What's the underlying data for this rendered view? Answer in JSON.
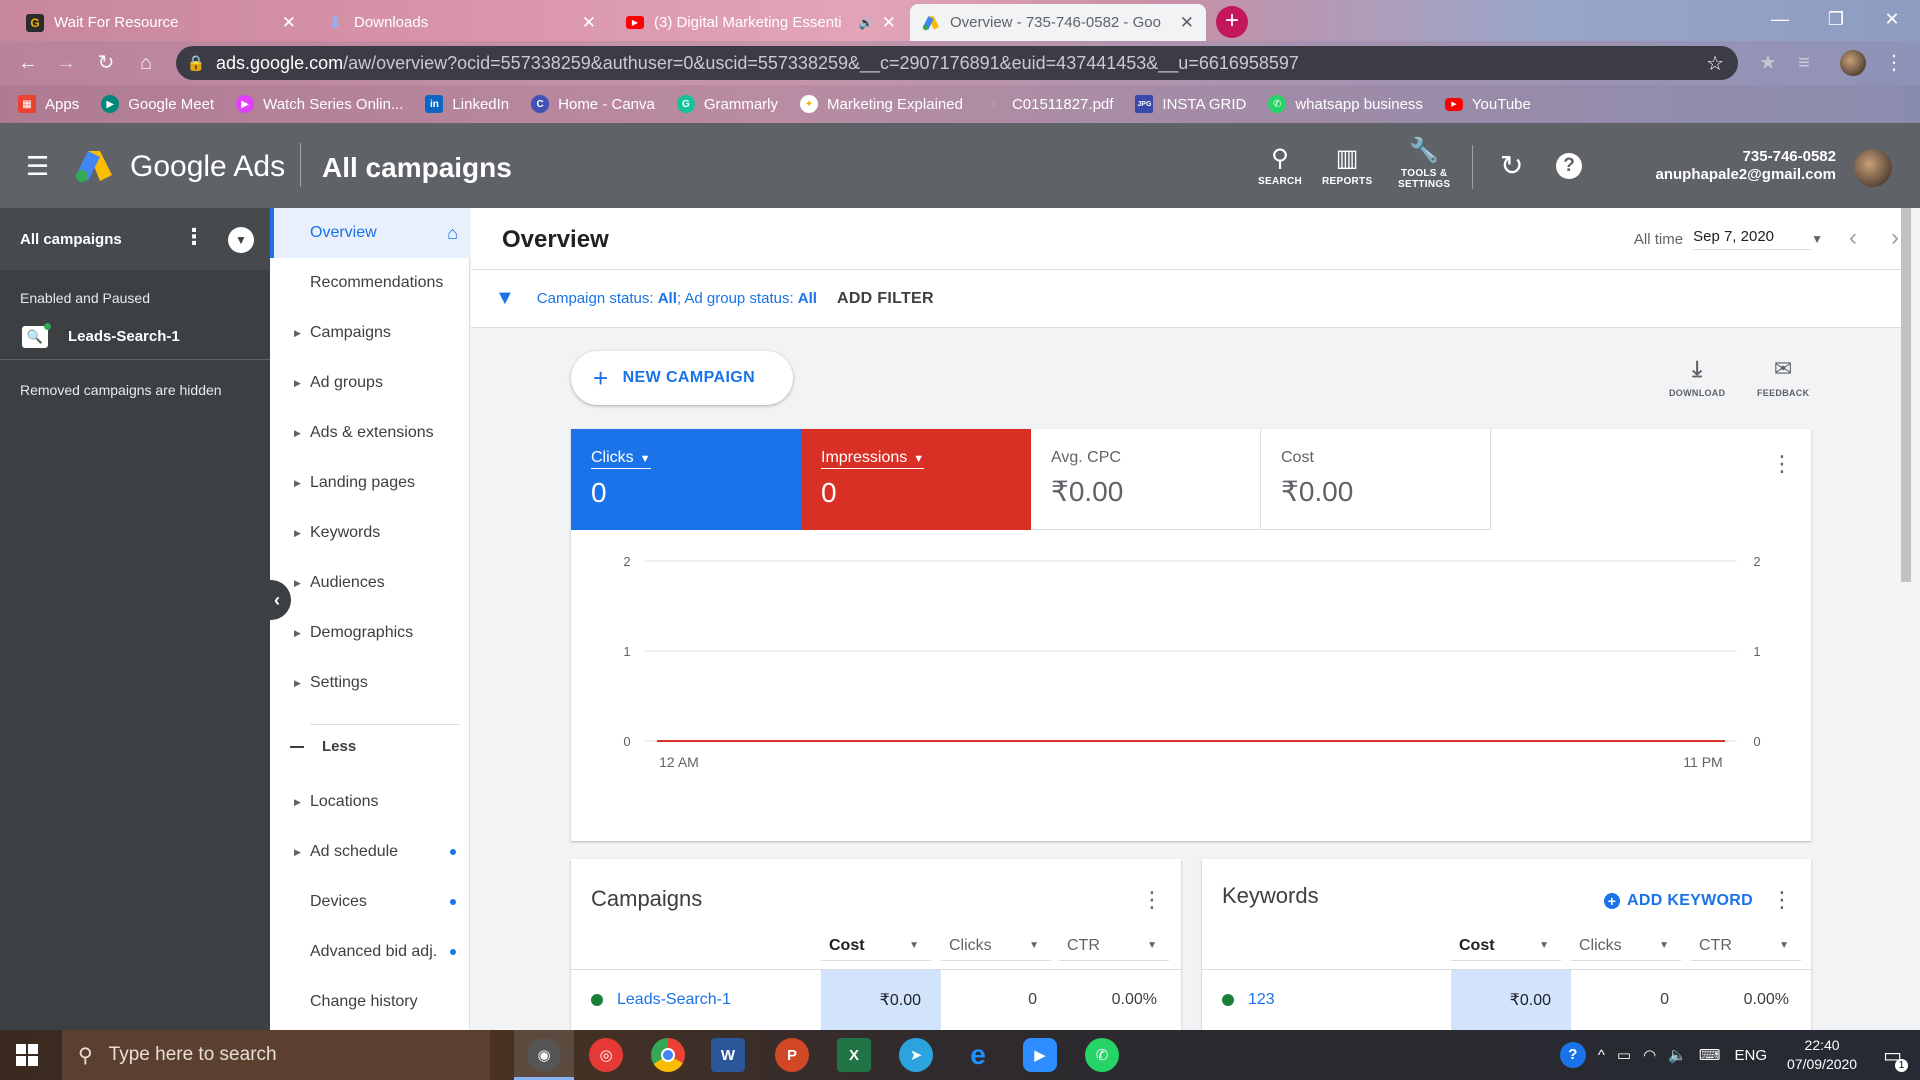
{
  "browser": {
    "tabs": [
      {
        "title": "Wait For Resource",
        "icon": "g-icon",
        "color": "#1a1a1a"
      },
      {
        "title": "Downloads",
        "icon": "download-icon",
        "color": "#4285f4"
      },
      {
        "title": "(3) Digital Marketing Essenti",
        "icon": "youtube-icon",
        "color": "#ff0000"
      },
      {
        "title": "Overview - 735-746-0582 - Goo",
        "icon": "google-ads-icon",
        "color": "#fbbc04"
      }
    ],
    "url_host": "ads.google.com",
    "url_path": "/aw/overview?ocid=557338259&authuser=0&uscid=557338259&__c=2907176891&euid=437441453&__u=6616958597",
    "bookmarks": [
      {
        "label": "Apps",
        "color": "#ea4335"
      },
      {
        "label": "Google Meet",
        "color": "#00897b"
      },
      {
        "label": "Watch Series Onlin...",
        "color": "#e040fb"
      },
      {
        "label": "LinkedIn",
        "color": "#0a66c2"
      },
      {
        "label": "Home - Canva",
        "color": "#00c4cc"
      },
      {
        "label": "Grammarly",
        "color": "#15c39a"
      },
      {
        "label": "Marketing Explained",
        "color": "#f4b400"
      },
      {
        "label": "C01511827.pdf",
        "color": "#9e9e9e"
      },
      {
        "label": "INSTA GRID",
        "color": "#3949ab"
      },
      {
        "label": "whatsapp business",
        "color": "#25d366"
      },
      {
        "label": "YouTube",
        "color": "#ff0000"
      }
    ]
  },
  "header": {
    "brand": "Google Ads",
    "title": "All campaigns",
    "icons": [
      {
        "label": "SEARCH"
      },
      {
        "label": "REPORTS"
      },
      {
        "label": "TOOLS &",
        "label2": "SETTINGS"
      }
    ],
    "account_id": "735-746-0582",
    "email": "anuphapale2@gmail.com"
  },
  "left_panel": {
    "title": "All campaigns",
    "group_label": "Enabled and Paused",
    "campaign": "Leads-Search-1",
    "note": "Removed campaigns are hidden"
  },
  "nav": {
    "items": [
      {
        "label": "Overview",
        "active": true
      },
      {
        "label": "Recommendations"
      },
      {
        "label": "Campaigns",
        "caret": true
      },
      {
        "label": "Ad groups",
        "caret": true
      },
      {
        "label": "Ads & extensions",
        "caret": true
      },
      {
        "label": "Landing pages",
        "caret": true
      },
      {
        "label": "Keywords",
        "caret": true
      },
      {
        "label": "Audiences",
        "caret": true
      },
      {
        "label": "Demographics",
        "caret": true
      },
      {
        "label": "Settings",
        "caret": true
      }
    ],
    "less_label": "Less",
    "more_items": [
      {
        "label": "Locations",
        "caret": true
      },
      {
        "label": "Ad schedule",
        "caret": true,
        "dot": true
      },
      {
        "label": "Devices",
        "dot": true
      },
      {
        "label": "Advanced bid adj.",
        "dot": true
      },
      {
        "label": "Change history"
      }
    ]
  },
  "overview": {
    "title": "Overview",
    "date_label": "All time",
    "date_value": "Sep 7, 2020",
    "filter_prefix": "Campaign status: ",
    "filter_v1": "All",
    "filter_mid": "; Ad group status: ",
    "filter_v2": "All",
    "add_filter": "ADD FILTER",
    "new_campaign": "NEW CAMPAIGN",
    "download": "DOWNLOAD",
    "feedback": "FEEDBACK"
  },
  "metrics": [
    {
      "label": "Clicks",
      "value": "0",
      "color": "#1a73e8"
    },
    {
      "label": "Impressions",
      "value": "0",
      "color": "#d93025"
    },
    {
      "label": "Avg. CPC",
      "value": "₹0.00"
    },
    {
      "label": "Cost",
      "value": "₹0.00"
    }
  ],
  "chart_data": {
    "type": "line",
    "x_labels": [
      "12 AM",
      "11 PM"
    ],
    "y_ticks": [
      0,
      1,
      2
    ],
    "ylim": [
      0,
      2
    ],
    "series": [
      {
        "name": "Clicks",
        "color": "#1a73e8",
        "values": [
          0,
          0
        ]
      },
      {
        "name": "Impressions",
        "color": "#d93025",
        "values": [
          0,
          0
        ]
      }
    ],
    "grid": true
  },
  "campaigns_card": {
    "title": "Campaigns",
    "columns": [
      "Cost",
      "Clicks",
      "CTR"
    ],
    "rows": [
      {
        "name": "Leads-Search-1",
        "cost": "₹0.00",
        "clicks": "0",
        "ctr": "0.00%"
      }
    ]
  },
  "keywords_card": {
    "title": "Keywords",
    "add_label": "ADD KEYWORD",
    "columns": [
      "Cost",
      "Clicks",
      "CTR"
    ],
    "rows": [
      {
        "name": "123",
        "cost": "₹0.00",
        "clicks": "0",
        "ctr": "0.00%"
      }
    ]
  },
  "taskbar": {
    "search_placeholder": "Type here to search",
    "lang": "ENG",
    "time": "22:40",
    "date": "07/09/2020",
    "notif_count": "1"
  }
}
